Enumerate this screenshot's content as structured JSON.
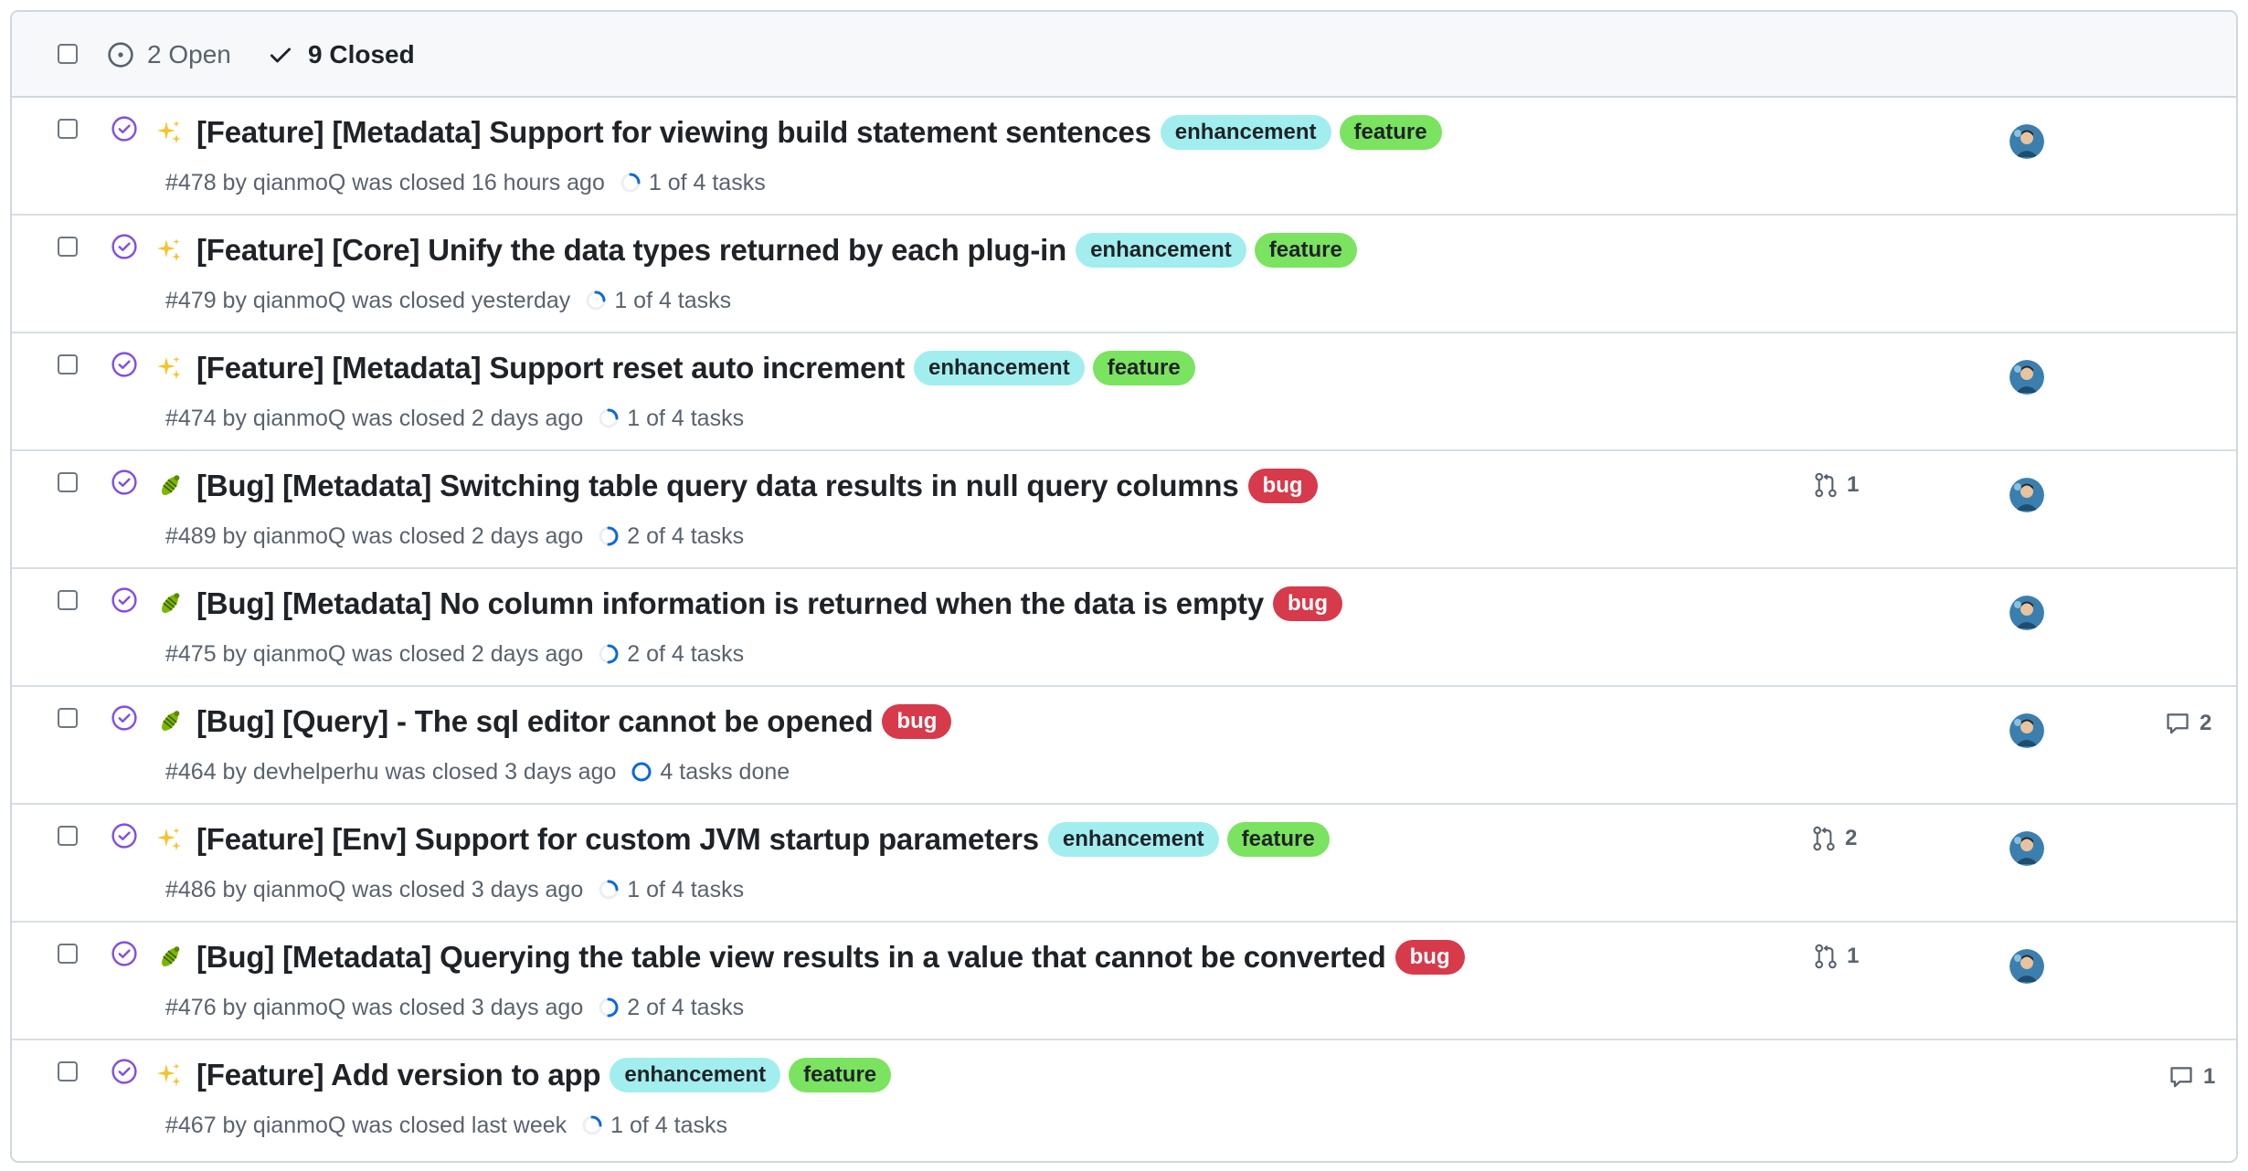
{
  "header": {
    "open_label": "2 Open",
    "closed_label": "9 Closed"
  },
  "colors": {
    "closed_icon": "#8250df",
    "enhancement_label": "#a2eeef",
    "feature_label": "#7ae35f",
    "bug_label": "#d73a4a",
    "task_progress": "#0969da"
  },
  "issues": [
    {
      "emoji": "sparkles",
      "title": "[Feature] [Metadata] Support for viewing build statement sentences",
      "labels": [
        "enhancement",
        "feature"
      ],
      "meta": "#478 by qianmoQ was closed 16 hours ago",
      "tasks": "1 of 4 tasks",
      "tasks_done": 0.25,
      "prs": "",
      "comments": "",
      "has_avatar": true
    },
    {
      "emoji": "sparkles",
      "title": "[Feature] [Core] Unify the data types returned by each plug-in",
      "labels": [
        "enhancement",
        "feature"
      ],
      "meta": "#479 by qianmoQ was closed yesterday",
      "tasks": "1 of 4 tasks",
      "tasks_done": 0.25,
      "prs": "",
      "comments": "",
      "has_avatar": false
    },
    {
      "emoji": "sparkles",
      "title": "[Feature] [Metadata] Support reset auto increment",
      "labels": [
        "enhancement",
        "feature"
      ],
      "meta": "#474 by qianmoQ was closed 2 days ago",
      "tasks": "1 of 4 tasks",
      "tasks_done": 0.25,
      "prs": "",
      "comments": "",
      "has_avatar": true
    },
    {
      "emoji": "bug",
      "title": "[Bug] [Metadata] Switching table query data results in null query columns",
      "labels": [
        "bug"
      ],
      "meta": "#489 by qianmoQ was closed 2 days ago",
      "tasks": "2 of 4 tasks",
      "tasks_done": 0.5,
      "prs": "1",
      "comments": "",
      "has_avatar": true
    },
    {
      "emoji": "bug",
      "title": "[Bug] [Metadata] No column information is returned when the data is empty",
      "labels": [
        "bug"
      ],
      "meta": "#475 by qianmoQ was closed 2 days ago",
      "tasks": "2 of 4 tasks",
      "tasks_done": 0.5,
      "prs": "",
      "comments": "",
      "has_avatar": true
    },
    {
      "emoji": "bug",
      "title": "[Bug] [Query] - The sql editor cannot be opened",
      "labels": [
        "bug"
      ],
      "meta": "#464 by devhelperhu was closed 3 days ago",
      "tasks": "4 tasks done",
      "tasks_done": 1,
      "prs": "",
      "comments": "2",
      "has_avatar": true
    },
    {
      "emoji": "sparkles",
      "title": "[Feature] [Env] Support for custom JVM startup parameters",
      "labels": [
        "enhancement",
        "feature"
      ],
      "meta": "#486 by qianmoQ was closed 3 days ago",
      "tasks": "1 of 4 tasks",
      "tasks_done": 0.25,
      "prs": "2",
      "comments": "",
      "has_avatar": true
    },
    {
      "emoji": "bug",
      "title": "[Bug] [Metadata] Querying the table view results in a value that cannot be converted",
      "labels": [
        "bug"
      ],
      "meta": "#476 by qianmoQ was closed 3 days ago",
      "tasks": "2 of 4 tasks",
      "tasks_done": 0.5,
      "prs": "1",
      "comments": "",
      "has_avatar": true
    },
    {
      "emoji": "sparkles",
      "title": "[Feature] Add version to app",
      "labels": [
        "enhancement",
        "feature"
      ],
      "meta": "#467 by qianmoQ was closed last week",
      "tasks": "1 of 4 tasks",
      "tasks_done": 0.25,
      "prs": "",
      "comments": "1",
      "has_avatar": false
    }
  ]
}
